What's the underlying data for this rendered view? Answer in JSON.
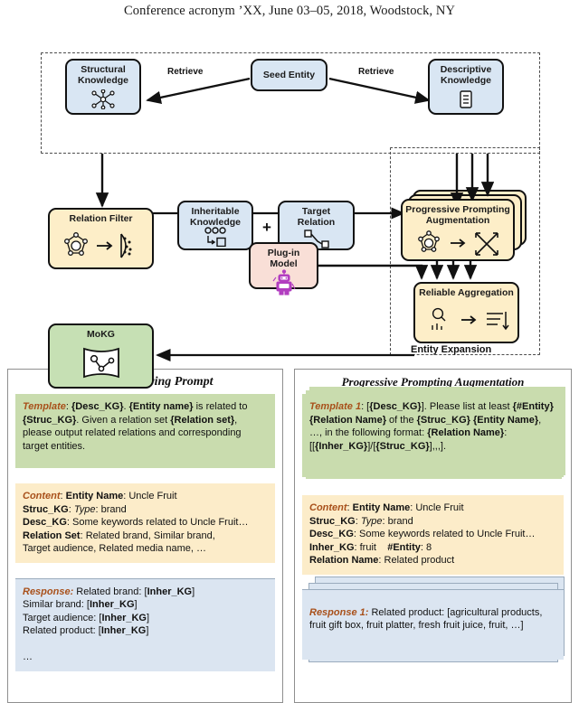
{
  "header": {
    "text": "Conference acronym ’XX, June 03–05, 2018, Woodstock, NY"
  },
  "diagram": {
    "nodes": {
      "structural_knowledge": "Structural Knowledge",
      "seed_entity": "Seed Entity",
      "descriptive_knowledge": "Descriptive Knowledge",
      "relation_filter": "Relation Filter",
      "inheritable_knowledge": "Inheritable Knowledge",
      "target_relation": "Target Relation",
      "progressive_prompting_augmentation": "Progressive Prompting Augmentation",
      "plug_in_model": "Plug-in Model",
      "reliable_aggregation": "Reliable Aggregation",
      "mokg": "MoKG"
    },
    "edge_labels": {
      "retrieve_left": "Retrieve",
      "retrieve_right": "Retrieve"
    },
    "plus_symbol": "+",
    "group_caption": "Entity Expansion",
    "colors": {
      "blue": "#d9e6f3",
      "yellow": "#fdeec8",
      "green": "#c6e0b4",
      "pink": "#f9dfd7",
      "outline": "#111111",
      "dashed": "#4c4c4c"
    }
  },
  "panels": {
    "left": {
      "title": "Relation Filtering Prompt",
      "template": {
        "label": "Template",
        "body": ": {Desc_KG}. {Entity name} is related to {Struc_KG}. Given a relation set {Relation set}, please output related relations and corresponding target entities."
      },
      "content": {
        "label": "Content",
        "lines": [
          "Entity Name: Uncle Fruit",
          "Struc_KG: Type: brand",
          "Desc_KG: Some keywords related to Uncle Fruit…",
          "Relation Set: Related brand, Similar brand,",
          "Target audience, Related media name, …"
        ]
      },
      "response": {
        "label": "Response:",
        "lines": [
          "Related brand: [Inher_KG]",
          "Similar brand: [Inher_KG]",
          "Target audience: [Inher_KG]",
          "Related product: [Inher_KG]",
          "…"
        ]
      }
    },
    "right": {
      "title": "Progressive Prompting Augmentation",
      "template": {
        "label": "Template 1",
        "body": ": [{Desc_KG}]. Please list at least {#Entity} {Relation Name} of the {Struc_KG} {Entity Name}, …, in the following format: {Relation Name}: [[{Inher_KG}]/[{Struc_KG}],,,]."
      },
      "content": {
        "label": "Content",
        "lines": [
          "Entity Name: Uncle Fruit",
          "Struc_KG:  Type: brand",
          "Desc_KG: Some keywords related to Uncle Fruit…",
          "Inher_KG: fruit     #Entity: 8",
          "Relation Name: Related product"
        ]
      },
      "response": {
        "label": "Response 1:",
        "lines": [
          "Related product: [agricultural products, fruit gift box, fruit platter, fresh fruit juice, fruit, …]"
        ]
      }
    }
  }
}
